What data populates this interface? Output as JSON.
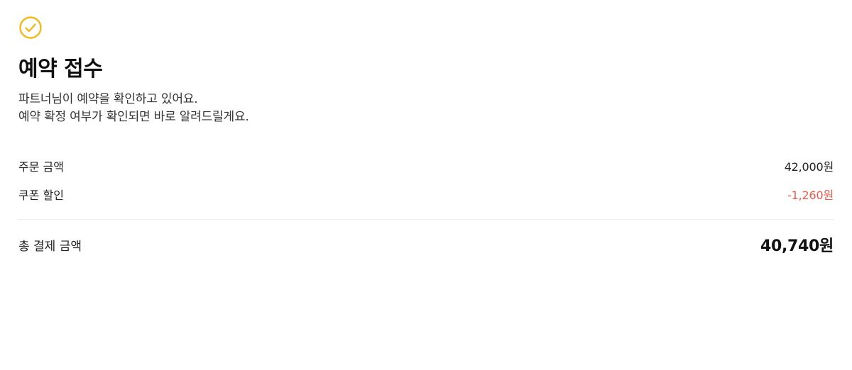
{
  "status": {
    "icon": "check-circle-icon",
    "icon_color": "#f5b81c",
    "title": "예약 접수",
    "description_lines": [
      "파트너님이 예약을 확인하고 있어요.",
      "예약 확정 여부가 확인되면 바로 알려드릴게요."
    ]
  },
  "payment": {
    "order_amount": {
      "label": "주문 금액",
      "value": "42,000원"
    },
    "coupon_discount": {
      "label": "쿠폰 할인",
      "value": "-1,260원",
      "color": "#f15a4a"
    },
    "total": {
      "label": "총 결제 금액",
      "value": "40,740원"
    }
  }
}
